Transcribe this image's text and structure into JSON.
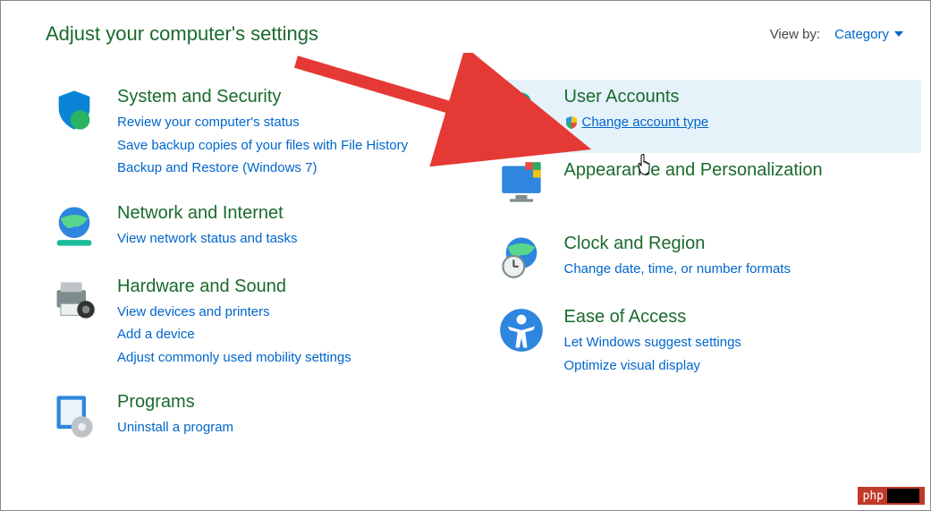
{
  "header": {
    "title": "Adjust your computer's settings",
    "viewby_label": "View by:",
    "viewby_value": "Category"
  },
  "left": [
    {
      "title": "System and Security",
      "links": [
        "Review your computer's status",
        "Save backup copies of your files with File History",
        "Backup and Restore (Windows 7)"
      ]
    },
    {
      "title": "Network and Internet",
      "links": [
        "View network status and tasks"
      ]
    },
    {
      "title": "Hardware and Sound",
      "links": [
        "View devices and printers",
        "Add a device",
        "Adjust commonly used mobility settings"
      ]
    },
    {
      "title": "Programs",
      "links": [
        "Uninstall a program"
      ]
    }
  ],
  "right": [
    {
      "title": "User Accounts",
      "links_shield": [
        "Change account type"
      ]
    },
    {
      "title": "Appearance and Personalization",
      "links": []
    },
    {
      "title": "Clock and Region",
      "links": [
        "Change date, time, or number formats"
      ]
    },
    {
      "title": "Ease of Access",
      "links": [
        "Let Windows suggest settings",
        "Optimize visual display"
      ]
    }
  ],
  "badge": "php"
}
